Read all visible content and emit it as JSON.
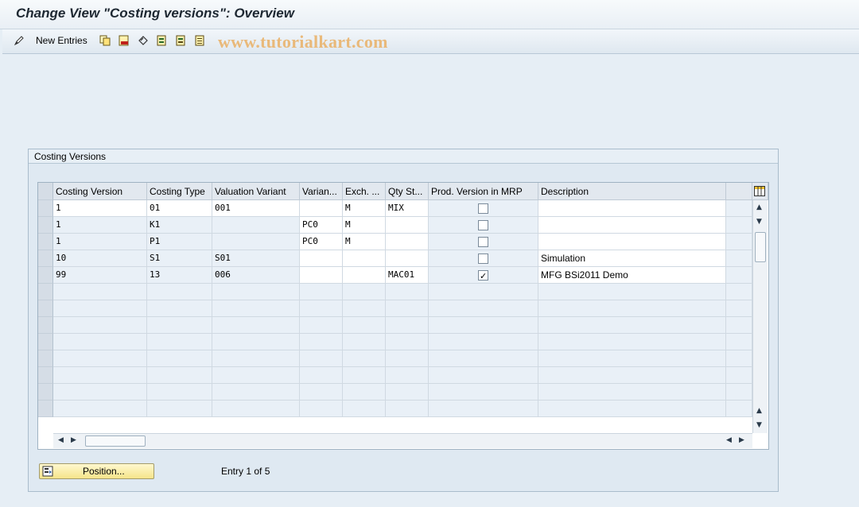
{
  "window": {
    "title": "Change View \"Costing versions\": Overview"
  },
  "toolbar": {
    "new_entries_label": "New Entries",
    "watermark": "www.tutorialkart.com",
    "icons": [
      "edit-icon",
      "copy-icon",
      "delete-icon",
      "undo-icon",
      "select-all-icon",
      "select-block-icon",
      "deselect-all-icon"
    ]
  },
  "group": {
    "title": "Costing Versions"
  },
  "table": {
    "columns": [
      "Costing Version",
      "Costing Type",
      "Valuation Variant",
      "Varian...",
      "Exch. ...",
      "Qty St...",
      "Prod. Version in MRP",
      "Description"
    ],
    "rows": [
      {
        "costing_version": "1",
        "costing_type": "01",
        "valuation_variant": "001",
        "variant": "",
        "exch": "M",
        "qty_st": "MIX",
        "prod_version_mrp": false,
        "description": ""
      },
      {
        "costing_version": "1",
        "costing_type": "K1",
        "valuation_variant": "",
        "variant": "PC0",
        "exch": "M",
        "qty_st": "",
        "prod_version_mrp": false,
        "description": ""
      },
      {
        "costing_version": "1",
        "costing_type": "P1",
        "valuation_variant": "",
        "variant": "PC0",
        "exch": "M",
        "qty_st": "",
        "prod_version_mrp": false,
        "description": ""
      },
      {
        "costing_version": "10",
        "costing_type": "S1",
        "valuation_variant": "S01",
        "variant": "",
        "exch": "",
        "qty_st": "",
        "prod_version_mrp": false,
        "description": "Simulation"
      },
      {
        "costing_version": "99",
        "costing_type": "13",
        "valuation_variant": "006",
        "variant": "",
        "exch": "",
        "qty_st": "MAC01",
        "prod_version_mrp": true,
        "description": "MFG BSi2011 Demo"
      }
    ]
  },
  "footer": {
    "position_button_label": "Position...",
    "entry_text": "Entry 1 of 5"
  }
}
